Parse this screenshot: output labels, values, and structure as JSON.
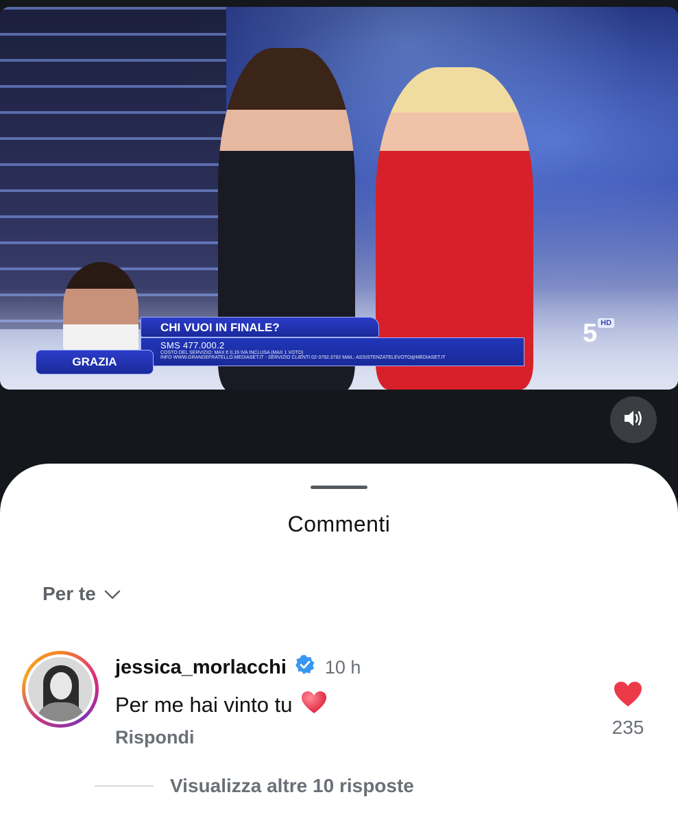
{
  "video": {
    "banner_title": "CHI VUOI IN FINALE?",
    "banner_sms": "SMS 477.000.2",
    "banner_cost": "COSTO DEL SERVIZIO: MAX € 0,16 IVA INCLUSA (MAX 1 VOTO)",
    "banner_info": "INFO WWW.GRANDEFRATELLO.MEDIASET.IT - SERVIZIO CLIENTI 02-3792.3792 MAIL: ASSISTENZATELEVOTO@MEDIASET.IT",
    "contestant_name": "GRAZIA",
    "channel": "5",
    "channel_hd": "HD",
    "mute_icon": "speaker-icon"
  },
  "sheet": {
    "title": "Commenti",
    "filter_label": "Per te"
  },
  "comment": {
    "username": "jessica_morlacchi",
    "time": "10 h",
    "text": "Per me hai vinto tu",
    "reply_label": "Rispondi",
    "like_count": "235",
    "more_replies_label": "Visualizza altre 10 risposte"
  },
  "colors": {
    "like": "#ed3a4a",
    "verified": "#3897f0",
    "muted_text": "#6b7077"
  }
}
